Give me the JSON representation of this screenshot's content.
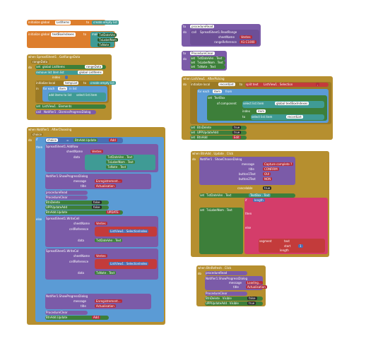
{
  "globals": {
    "list_init": {
      "label": "initialize global",
      "name": "ListItems",
      "to": "to",
      "value": "create empty list"
    },
    "text_init": {
      "label": "initialize global",
      "name": "textBoxIndexes",
      "to": "to",
      "make": "make a list",
      "items": [
        "TxtDateVen",
        "TxLabelNom",
        "TxNote"
      ]
    }
  },
  "procedures": {
    "pre_read": {
      "to": "to",
      "name": "procedureRead",
      "do": "do",
      "call": "call",
      "target": "SpreadSheet1.ReadRange",
      "sheetname": "sheetName",
      "sheet_value": "Ventes",
      "rangeref": "rangeReference",
      "range_value": "A1:C1000"
    },
    "clear": {
      "to": "to",
      "name": "ProcedureClear",
      "do": "do",
      "set": "set",
      "rows": [
        "TxtDateVen . Text",
        "TxLabelNom . Text",
        "TxNote . Text"
      ],
      "to_label": "to"
    }
  },
  "events": {
    "got_range": {
      "when": "when",
      "name": "SpreadSheet1 . GotRangeData",
      "range": "rangeData",
      "do": "do",
      "set": "set",
      "global": "global ListItems",
      "to": "to",
      "get": "get",
      "range_value": "rangeData",
      "remove": "remove list item list",
      "index": "index",
      "init_local": "initialize local",
      "local_name": "tempList",
      "local_to": "to",
      "empty": "create empty list",
      "in": "in",
      "for_each": "for each",
      "item": "item",
      "in_list": "in list",
      "add_items": "add items to list",
      "select": "select list item",
      "elements": "elements",
      "ok_list": "ListView1 . Elements",
      "call": "call",
      "dismiss": "Notifier1 . DismissProgressDialog"
    },
    "after_choosing": {
      "when": "when",
      "name": "Notifier1 . AfterChoosing",
      "choice": "choice",
      "do": "do",
      "if": "if",
      "then": "then",
      "else": "else",
      "compare": "=",
      "choice_value": "Add",
      "btn": "BtnAdd.Update",
      "btn_text": "Text",
      "add": "Add",
      "spreadsheet_addrow": "SpreadSheet1.AddRow",
      "sheetname": "sheetName",
      "data": "data",
      "progress": "Notifier1.ShowProgressDialog",
      "message": "message",
      "title": "title",
      "progress_msg": "Enregistrement...",
      "progress_title": "Actualisation",
      "proc_read": "procedureRead",
      "proc_clear": "ProcedureClear",
      "visible": "Visible",
      "false_v": "false",
      "true_v": "true",
      "update": "UPDATE",
      "writecell": "SpreadSheet1.WriteCell",
      "writecol": "SpreadSheet1.WriteCol",
      "cellref": "cellReference",
      "rowdel": "SpreadSheet1.RemoveRow",
      "rownumber": "rowNumber",
      "selection_index": "ListView1 . SelectionIndex",
      "plus": "+",
      "one": "1"
    },
    "list_picked": {
      "when": "when",
      "name": "ListView1 . AfterPicking",
      "do": "do",
      "init_local": "initialize local",
      "local": "recordList",
      "to": "to",
      "list_func": "split text",
      "text": "text",
      "at": "at",
      "selection": "ListView1 . Selection",
      "comma": ",",
      "for_each": "for each",
      "item": "item",
      "from": "from",
      "to_v": "to",
      "by": "by",
      "set": "set",
      "textbox": "TextBox",
      "of_component": "of component",
      "select": "select list item",
      "index": "index",
      "in_list": "list",
      "get": "get",
      "add": "global textBoxIndexes",
      "component": "TextBox",
      "property": "Text",
      "visible": "Visible",
      "true_v": "true",
      "false_v": "false",
      "btn_delete": "BtnDelete",
      "upp": "UPPUpdateAdd",
      "btnadd": "BtnAdd",
      "text_label": "Text",
      "edit": "Edit"
    },
    "btn_add": {
      "when": "when",
      "name": "BtnAdd . Update . Click",
      "do": "do",
      "call": "call",
      "choose": "Notifier1 . ShowChooseDialog",
      "message": "message",
      "title": "title",
      "button1": "button1Text",
      "button2": "button2Text",
      "cancelable": "cancelable",
      "msg_val": "Capture complete ?",
      "title_val": "CONFIRM",
      "yes": "OUI",
      "no": "NON",
      "true_v": "true",
      "if": "if",
      "then": "then",
      "else": "else",
      "set": "set",
      "date_text": "TxtDateVen . Text",
      "to": "to",
      "is_empty": "is empty",
      "get_date": "TextBox . Text",
      "length": "length",
      "segment": "segment",
      "start": "start",
      "text_label": "text",
      "label_text": "TxLabelNom . Text",
      "and": "and",
      "join": "join",
      "minus": "-",
      "one": "1"
    },
    "btn_refresh": {
      "when": "when",
      "name": "BtnRefresh . Click",
      "do": "do",
      "call": "call",
      "proc": "procedureRead",
      "progress": "Notifier1.ShowProgressDialog",
      "message": "message",
      "title": "title",
      "msg": "Loading...",
      "title_val": "Actualisation",
      "proc_clear": "ProcedureClear",
      "set": "set",
      "delete": "BtnDelete . Visible",
      "upp": "UPPUpdateAdd . Visible",
      "to": "to",
      "true_v": "true",
      "false_v": "false"
    }
  },
  "colors": {
    "orange": "#dd7e2d",
    "gold": "#b68f2f",
    "purple": "#7b5ba8",
    "green": "#3d7f3a",
    "teal": "#3f9b95",
    "blue": "#4a6fb3",
    "red": "#c33b3b"
  }
}
